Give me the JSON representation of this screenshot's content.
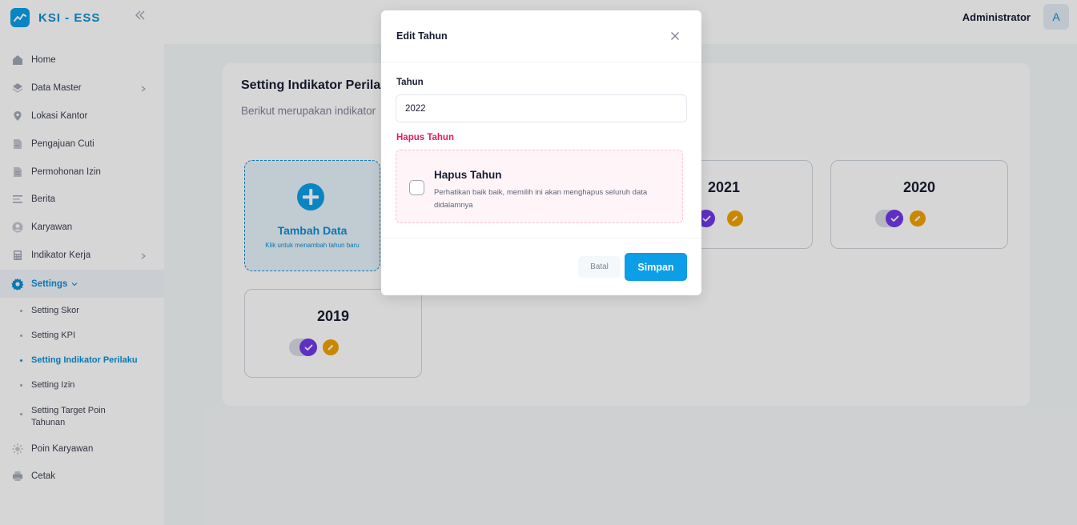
{
  "app": {
    "name": "KSI - ESS"
  },
  "header": {
    "user_name": "Administrator",
    "avatar_initial": "A"
  },
  "sidebar": {
    "items": [
      {
        "label": "Home",
        "icon": "home-icon"
      },
      {
        "label": "Data Master",
        "icon": "layers-icon",
        "has_arrow": true
      },
      {
        "label": "Lokasi Kantor",
        "icon": "map-pin-icon"
      },
      {
        "label": "Pengajuan Cuti",
        "icon": "document-icon"
      },
      {
        "label": "Permohonan Izin",
        "icon": "document-lines-icon"
      },
      {
        "label": "Berita",
        "icon": "text-lines-icon"
      },
      {
        "label": "Karyawan",
        "icon": "user-icon"
      },
      {
        "label": "Indikator Kerja",
        "icon": "calculator-icon",
        "has_arrow": true
      },
      {
        "label": "Settings",
        "icon": "gear-icon",
        "expanded": true
      }
    ],
    "settings_sub": [
      {
        "label": "Setting Skor"
      },
      {
        "label": "Setting KPI"
      },
      {
        "label": "Setting Indikator Perilaku",
        "active": true
      },
      {
        "label": "Setting Izin"
      },
      {
        "label": "Setting Target Poin Tahunan"
      }
    ],
    "bottom_items": [
      {
        "label": "Poin Karyawan",
        "icon": "sun-icon"
      },
      {
        "label": "Cetak",
        "icon": "printer-icon"
      }
    ]
  },
  "main": {
    "title": "Setting Indikator Perilaku",
    "subtitle": "Berikut merupakan indikator",
    "add_card": {
      "title": "Tambah Data",
      "subtitle": "Klik untuk menambah tahun baru"
    },
    "years": [
      "2021",
      "2020",
      "2019"
    ]
  },
  "modal": {
    "title": "Edit Tahun",
    "field_label": "Tahun",
    "field_value": "2022",
    "danger_label": "Hapus Tahun",
    "danger_box_title": "Hapus Tahun",
    "danger_box_text": "Perhatikan baik baik, memilih ini akan menghapus seluruh data didalamnya",
    "cancel_label": "Batal",
    "save_label": "Simpan"
  },
  "colors": {
    "accent": "#0D9EE8",
    "danger": "#E5195F",
    "toggle_on": "#7239EA",
    "edit": "#F1A200"
  }
}
